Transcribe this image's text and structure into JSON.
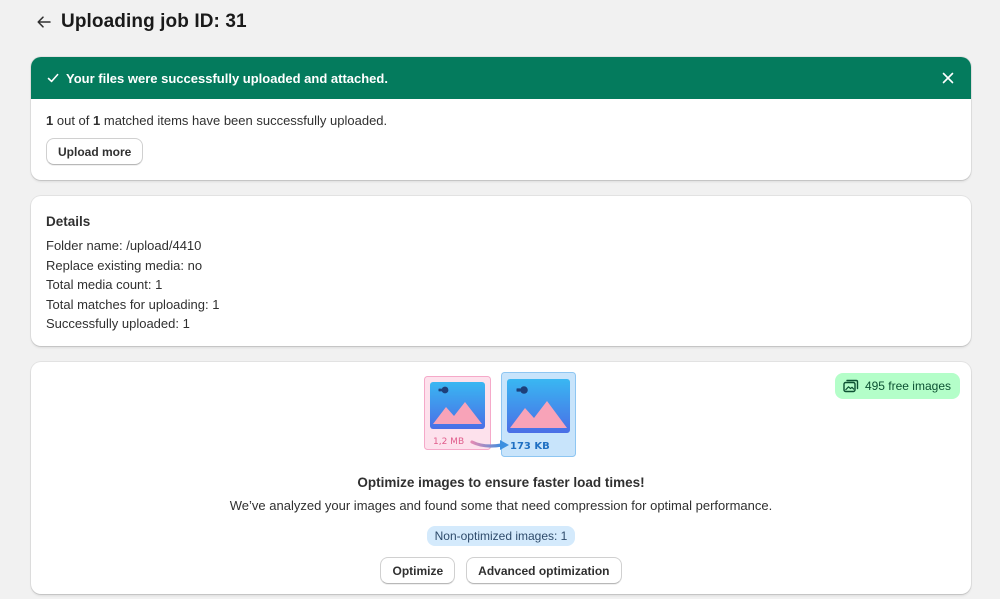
{
  "header": {
    "title": "Uploading job ID: 31",
    "back_icon": "arrow-left-icon"
  },
  "success": {
    "banner_text": "Your files were successfully uploaded and attached.",
    "banner_color": "#047b5d",
    "uploaded_count": "1",
    "out_of_text": "out of",
    "matched_count": "1",
    "summary_suffix": "matched items have been successfully uploaded.",
    "upload_more_label": "Upload more"
  },
  "details": {
    "title": "Details",
    "lines": [
      "Folder name: /upload/4410",
      "Replace existing media: no",
      "Total media count: 1",
      "Total matches for uploading: 1",
      "Successfully uploaded: 1"
    ]
  },
  "optimize": {
    "free_images_label": "495 free images",
    "before_size": "1,2 MB",
    "after_size": "173 KB",
    "title": "Optimize images to ensure faster load times!",
    "description": "We’ve analyzed your images and found some that need compression for optimal performance.",
    "non_optimized_label": "Non-optimized images: 1",
    "optimize_button": "Optimize",
    "advanced_button": "Advanced optimization",
    "badge_color": "#b4fec9",
    "info_badge_color": "#d4eafc"
  }
}
